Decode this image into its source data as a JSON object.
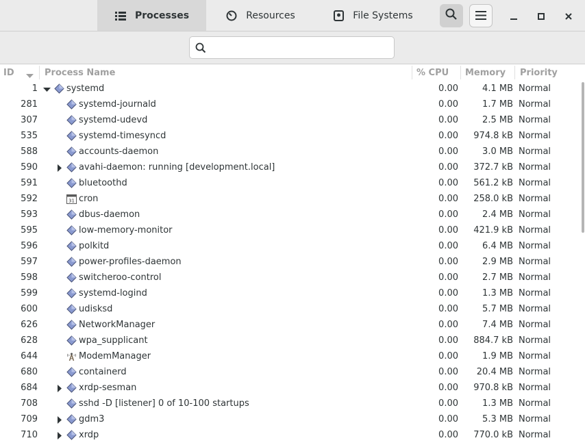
{
  "tabs": [
    {
      "label": "Processes",
      "icon": "list-icon",
      "active": true
    },
    {
      "label": "Resources",
      "icon": "gauge-icon",
      "active": false
    },
    {
      "label": "File Systems",
      "icon": "disk-icon",
      "active": false
    }
  ],
  "search": {
    "placeholder": "",
    "value": ""
  },
  "columns": {
    "id": "ID",
    "name": "Process Name",
    "cpu": "% CPU",
    "memory": "Memory",
    "priority": "Priority"
  },
  "processes": [
    {
      "id": "1",
      "name": "systemd",
      "cpu": "0.00",
      "memory": "4.1 MB",
      "priority": "Normal",
      "indent": 0,
      "expander": "expanded",
      "icon": "diamond-icon"
    },
    {
      "id": "281",
      "name": "systemd-journald",
      "cpu": "0.00",
      "memory": "1.7 MB",
      "priority": "Normal",
      "indent": 1,
      "expander": "none",
      "icon": "diamond-icon"
    },
    {
      "id": "307",
      "name": "systemd-udevd",
      "cpu": "0.00",
      "memory": "2.5 MB",
      "priority": "Normal",
      "indent": 1,
      "expander": "none",
      "icon": "diamond-icon"
    },
    {
      "id": "535",
      "name": "systemd-timesyncd",
      "cpu": "0.00",
      "memory": "974.8 kB",
      "priority": "Normal",
      "indent": 1,
      "expander": "none",
      "icon": "diamond-icon"
    },
    {
      "id": "588",
      "name": "accounts-daemon",
      "cpu": "0.00",
      "memory": "3.0 MB",
      "priority": "Normal",
      "indent": 1,
      "expander": "none",
      "icon": "diamond-icon"
    },
    {
      "id": "590",
      "name": "avahi-daemon: running [development.local]",
      "cpu": "0.00",
      "memory": "372.7 kB",
      "priority": "Normal",
      "indent": 1,
      "expander": "collapsed",
      "icon": "diamond-icon"
    },
    {
      "id": "591",
      "name": "bluetoothd",
      "cpu": "0.00",
      "memory": "561.2 kB",
      "priority": "Normal",
      "indent": 1,
      "expander": "none",
      "icon": "diamond-icon"
    },
    {
      "id": "592",
      "name": "cron",
      "cpu": "0.00",
      "memory": "258.0 kB",
      "priority": "Normal",
      "indent": 1,
      "expander": "none",
      "icon": "calendar-icon"
    },
    {
      "id": "593",
      "name": "dbus-daemon",
      "cpu": "0.00",
      "memory": "2.4 MB",
      "priority": "Normal",
      "indent": 1,
      "expander": "none",
      "icon": "diamond-icon"
    },
    {
      "id": "595",
      "name": "low-memory-monitor",
      "cpu": "0.00",
      "memory": "421.9 kB",
      "priority": "Normal",
      "indent": 1,
      "expander": "none",
      "icon": "diamond-icon"
    },
    {
      "id": "596",
      "name": "polkitd",
      "cpu": "0.00",
      "memory": "6.4 MB",
      "priority": "Normal",
      "indent": 1,
      "expander": "none",
      "icon": "diamond-icon"
    },
    {
      "id": "597",
      "name": "power-profiles-daemon",
      "cpu": "0.00",
      "memory": "2.9 MB",
      "priority": "Normal",
      "indent": 1,
      "expander": "none",
      "icon": "diamond-icon"
    },
    {
      "id": "598",
      "name": "switcheroo-control",
      "cpu": "0.00",
      "memory": "2.7 MB",
      "priority": "Normal",
      "indent": 1,
      "expander": "none",
      "icon": "diamond-icon"
    },
    {
      "id": "599",
      "name": "systemd-logind",
      "cpu": "0.00",
      "memory": "1.3 MB",
      "priority": "Normal",
      "indent": 1,
      "expander": "none",
      "icon": "diamond-icon"
    },
    {
      "id": "600",
      "name": "udisksd",
      "cpu": "0.00",
      "memory": "5.7 MB",
      "priority": "Normal",
      "indent": 1,
      "expander": "none",
      "icon": "diamond-icon"
    },
    {
      "id": "626",
      "name": "NetworkManager",
      "cpu": "0.00",
      "memory": "7.4 MB",
      "priority": "Normal",
      "indent": 1,
      "expander": "none",
      "icon": "diamond-icon"
    },
    {
      "id": "628",
      "name": "wpa_supplicant",
      "cpu": "0.00",
      "memory": "884.7 kB",
      "priority": "Normal",
      "indent": 1,
      "expander": "none",
      "icon": "diamond-icon"
    },
    {
      "id": "644",
      "name": "ModemManager",
      "cpu": "0.00",
      "memory": "1.9 MB",
      "priority": "Normal",
      "indent": 1,
      "expander": "none",
      "icon": "antenna-icon"
    },
    {
      "id": "680",
      "name": "containerd",
      "cpu": "0.00",
      "memory": "20.4 MB",
      "priority": "Normal",
      "indent": 1,
      "expander": "none",
      "icon": "diamond-icon"
    },
    {
      "id": "684",
      "name": "xrdp-sesman",
      "cpu": "0.00",
      "memory": "970.8 kB",
      "priority": "Normal",
      "indent": 1,
      "expander": "collapsed",
      "icon": "diamond-icon"
    },
    {
      "id": "708",
      "name": "sshd -D [listener] 0 of 10-100 startups",
      "cpu": "0.00",
      "memory": "1.3 MB",
      "priority": "Normal",
      "indent": 1,
      "expander": "none",
      "icon": "diamond-icon"
    },
    {
      "id": "709",
      "name": "gdm3",
      "cpu": "0.00",
      "memory": "5.3 MB",
      "priority": "Normal",
      "indent": 1,
      "expander": "collapsed",
      "icon": "diamond-icon"
    },
    {
      "id": "710",
      "name": "xrdp",
      "cpu": "0.00",
      "memory": "770.0 kB",
      "priority": "Normal",
      "indent": 1,
      "expander": "collapsed",
      "icon": "diamond-icon"
    }
  ],
  "colors": {
    "header_bg": "#ebebeb",
    "active_tab_bg": "#d8d8d8",
    "header_text": "#a0a0a0",
    "icon_fill": "#8a9ad0",
    "text": "#2e3436"
  }
}
